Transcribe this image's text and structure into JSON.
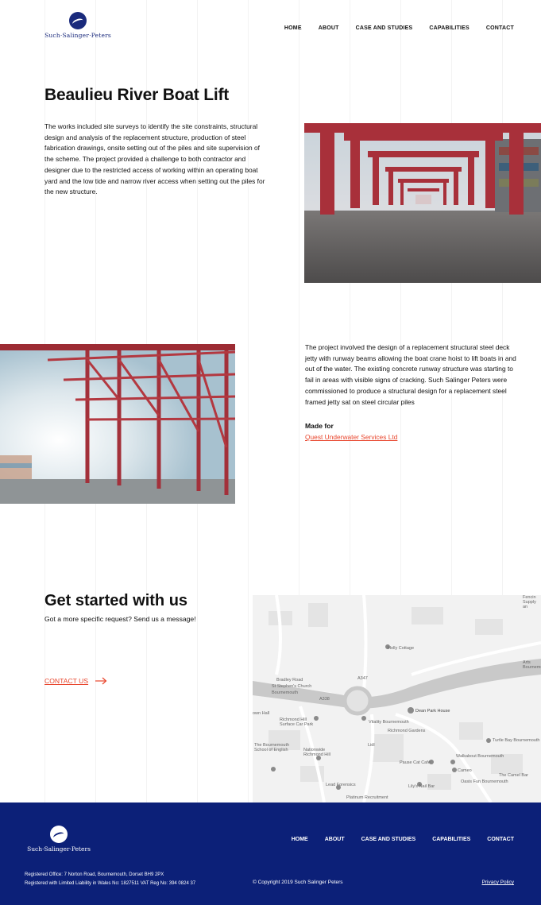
{
  "header": {
    "logo_text": "Such·Salinger·Peters",
    "nav": [
      "HOME",
      "ABOUT",
      "CASE AND STUDIES",
      "CAPABILITIES",
      "CONTACT"
    ]
  },
  "project": {
    "title": "Beaulieu River Boat Lift",
    "paragraph1": "The works included site surveys to identify the site constraints, structural design and analysis of the replacement structure, production of steel fabrication drawings, onsite setting out of the piles and site supervision of the scheme. The project provided a challenge to both contractor and designer due to the restricted access of working within an operating boat yard and the low tide and narrow river access when setting out the piles for the new structure.",
    "paragraph2": "The project involved the design of a replacement structural steel deck jetty with runway beams allowing the boat crane hoist to lift boats in and out of the water. The existing concrete runway structure was starting to fail in areas with visible signs of cracking. Such Salinger Peters were commissioned to produce a structural design for a replacement steel framed jetty sat on steel circular piles",
    "made_for_label": "Made for",
    "client": "Quest Underwater Services Ltd"
  },
  "get_started": {
    "title": "Get started with us",
    "subtitle": "Got a more specific request? Send us a message!",
    "contact_label": "CONTACT US"
  },
  "map": {
    "labels": [
      "Holly Cottage",
      "Bradley Road",
      "St Stephen's Church",
      "Bournemouth",
      "Richmond Hill Surface Car Park",
      "Vitality Bournemouth",
      "Dean Park House",
      "Richmond Gardens",
      "The Bournemouth School of English",
      "Nationwide Richmond Hill",
      "Pause Cat Café",
      "Walkabout Bournemouth",
      "Turtle Bay Bournemouth",
      "Cameo",
      "The Camel Bar",
      "Oasis Fun Bournemouth",
      "Lead Forensics",
      "Lily's Nail Bar",
      "Platinum Recruitment",
      "Lidl",
      "own Hall",
      "A338",
      "A347",
      "Fencin Supply an",
      "Arts Bournemo"
    ]
  },
  "footer": {
    "logo_text": "Such·Salinger·Peters",
    "nav": [
      "HOME",
      "ABOUT",
      "CASE AND STUDIES",
      "CAPABILITIES",
      "CONTACT"
    ],
    "registered_office": "Registered Office: 7 Norton Road, Bournemouth, Dorset BH9 2PX",
    "registration": "Registered with Limited Liability in Wales No: 1827511 VAT Reg No: 394 0824 37",
    "copyright": "© Copyright 2019 Such Salinger Peters",
    "privacy": "Privacy Policy"
  },
  "colors": {
    "brand_navy": "#0c2078",
    "accent_red": "#e8452c",
    "crane_red": "#a8303a"
  },
  "icons": [
    "logo-mark-icon",
    "arrow-right-icon",
    "map-pin-icon"
  ]
}
